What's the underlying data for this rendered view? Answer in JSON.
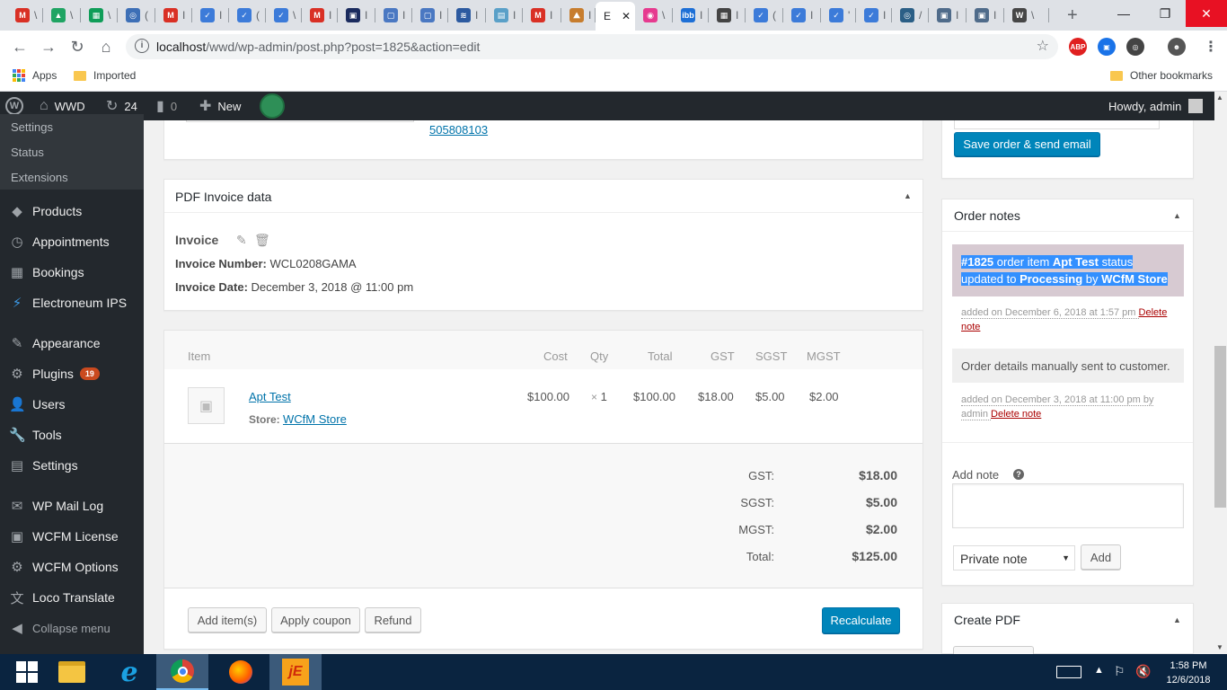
{
  "browser": {
    "tabs": [
      {
        "icon": "gmail-icon",
        "color": "#d93025",
        "letter": "M",
        "title": "\\"
      },
      {
        "icon": "drive-icon",
        "color": "#1fa463",
        "letter": "▲",
        "title": "\\"
      },
      {
        "icon": "sheets-icon",
        "color": "#0f9d58",
        "letter": "▦",
        "title": "\\"
      },
      {
        "icon": "site-icon",
        "color": "#3d6fb6",
        "letter": "◎",
        "title": "("
      },
      {
        "icon": "gmail-icon",
        "color": "#d93025",
        "letter": "M",
        "title": "I"
      },
      {
        "icon": "wcfm-icon",
        "color": "#3c7bd9",
        "letter": "✓",
        "title": "I"
      },
      {
        "icon": "wcfm-icon",
        "color": "#3c7bd9",
        "letter": "✓",
        "title": "("
      },
      {
        "icon": "wcfm-icon",
        "color": "#3c7bd9",
        "letter": "✓",
        "title": "\\"
      },
      {
        "icon": "gmail-icon",
        "color": "#d93025",
        "letter": "M",
        "title": "I"
      },
      {
        "icon": "site-icon",
        "color": "#1a2b5e",
        "letter": "▣",
        "title": "I"
      },
      {
        "icon": "doc-icon",
        "color": "#4a78c2",
        "letter": "▢",
        "title": "I"
      },
      {
        "icon": "doc-icon",
        "color": "#4a78c2",
        "letter": "▢",
        "title": "I"
      },
      {
        "icon": "site-icon",
        "color": "#2c5aa0",
        "letter": "≋",
        "title": "I"
      },
      {
        "icon": "site-icon",
        "color": "#5aa0c8",
        "letter": "▤",
        "title": "I"
      },
      {
        "icon": "gmail-icon",
        "color": "#d93025",
        "letter": "M",
        "title": "I"
      },
      {
        "icon": "site-icon",
        "color": "#c77d2e",
        "letter": "⛰",
        "title": "I"
      },
      {
        "icon": "active-tab",
        "color": "#ffffff",
        "letter": "",
        "title": "E"
      },
      {
        "icon": "site-icon",
        "color": "#e63a8f",
        "letter": "◉",
        "title": "\\"
      },
      {
        "icon": "site-icon",
        "color": "#1d6fd6",
        "letter": "ibb",
        "title": "I"
      },
      {
        "icon": "site-icon",
        "color": "#444444",
        "letter": "▦",
        "title": "I"
      },
      {
        "icon": "wcfm-icon",
        "color": "#3c7bd9",
        "letter": "✓",
        "title": "("
      },
      {
        "icon": "wcfm-icon",
        "color": "#3c7bd9",
        "letter": "✓",
        "title": "I"
      },
      {
        "icon": "wcfm-icon",
        "color": "#3c7bd9",
        "letter": "✓",
        "title": "'"
      },
      {
        "icon": "wcfm-icon",
        "color": "#3c7bd9",
        "letter": "✓",
        "title": "I"
      },
      {
        "icon": "site-icon",
        "color": "#2b5f86",
        "letter": "◎",
        "title": "/"
      },
      {
        "icon": "site-icon",
        "color": "#4f6b8a",
        "letter": "▣",
        "title": "I"
      },
      {
        "icon": "site-icon",
        "color": "#4f6b8a",
        "letter": "▣",
        "title": "I"
      },
      {
        "icon": "wordpress-icon",
        "color": "#464646",
        "letter": "W",
        "title": "\\"
      }
    ],
    "active_close": "✕",
    "new_tab": "+",
    "window_controls": {
      "minimize": "—",
      "restore": "❐",
      "close": "✕"
    },
    "url_host": "localhost",
    "url_path": "/wwd/wp-admin/post.php?post=1825&action=edit",
    "extensions": [
      "ABP",
      "▣",
      "◎",
      "☻",
      "⋮"
    ],
    "bookmarks": {
      "apps": "Apps",
      "imported": "Imported",
      "other": "Other bookmarks"
    }
  },
  "adminbar": {
    "site": "WWD",
    "updates": "24",
    "comments": "0",
    "new": "New",
    "howdy": "Howdy, admin"
  },
  "sidebar": {
    "submenu": [
      "Settings",
      "Status",
      "Extensions"
    ],
    "items": [
      {
        "label": "Products",
        "icon": "products-icon",
        "glyph": "◆"
      },
      {
        "label": "Appointments",
        "icon": "clock-icon",
        "glyph": "◷"
      },
      {
        "label": "Bookings",
        "icon": "calendar-icon",
        "glyph": "▦"
      },
      {
        "label": "Electroneum IPS",
        "icon": "electroneum-icon",
        "glyph": "⚡"
      },
      {
        "label": "Appearance",
        "icon": "brush-icon",
        "glyph": "✎"
      },
      {
        "label": "Plugins",
        "icon": "plugin-icon",
        "glyph": "⚙",
        "badge": "19"
      },
      {
        "label": "Users",
        "icon": "users-icon",
        "glyph": "👤"
      },
      {
        "label": "Tools",
        "icon": "wrench-icon",
        "glyph": "🔧"
      },
      {
        "label": "Settings",
        "icon": "settings-icon",
        "glyph": "▤"
      },
      {
        "label": "WP Mail Log",
        "icon": "mail-icon",
        "glyph": "✉"
      },
      {
        "label": "WCFM License",
        "icon": "license-icon",
        "glyph": "▣"
      },
      {
        "label": "WCFM Options",
        "icon": "gear-icon",
        "glyph": "⚙"
      },
      {
        "label": "Loco Translate",
        "icon": "translate-icon",
        "glyph": "文"
      },
      {
        "label": "Collapse menu",
        "icon": "collapse-icon",
        "glyph": "◀"
      }
    ]
  },
  "address": {
    "phone": "505808103"
  },
  "pdf_invoice": {
    "title": "PDF Invoice data",
    "subtitle": "Invoice",
    "number_label": "Invoice Number:",
    "number": "WCL0208GAMA",
    "date_label": "Invoice Date:",
    "date": "December 3, 2018 @ 11:00 pm"
  },
  "items": {
    "headers": {
      "item": "Item",
      "cost": "Cost",
      "qty": "Qty",
      "total": "Total",
      "gst": "GST",
      "sgst": "SGST",
      "mgst": "MGST"
    },
    "row": {
      "name": "Apt Test",
      "store_label": "Store:",
      "store": "WCfM Store",
      "cost": "$100.00",
      "qty_x": "×",
      "qty": "1",
      "total": "$100.00",
      "gst": "$18.00",
      "sgst": "$5.00",
      "mgst": "$2.00"
    }
  },
  "totals": [
    {
      "label": "GST:",
      "value": "$18.00"
    },
    {
      "label": "SGST:",
      "value": "$5.00"
    },
    {
      "label": "MGST:",
      "value": "$2.00"
    },
    {
      "label": "Total:",
      "value": "$125.00"
    }
  ],
  "buttons": {
    "add_items": "Add item(s)",
    "apply_coupon": "Apply coupon",
    "refund": "Refund",
    "recalculate": "Recalculate",
    "save_order": "Save order & send email",
    "add": "Add"
  },
  "order_notes": {
    "title": "Order notes",
    "note1": {
      "order": "#1825",
      "t1": " order item ",
      "item": "Apt Test",
      "t2": " status updated to ",
      "status": "Processing",
      "t3": " by ",
      "store": "WCfM Store",
      "meta": "added on December 6, 2018 at 1:57 pm ",
      "delete": "Delete note"
    },
    "note2": {
      "text": "Order details manually sent to customer.",
      "meta": "added on December 3, 2018 at 11:00 pm by admin ",
      "delete": "Delete note"
    },
    "add_note_label": "Add note",
    "help": "?",
    "note_type": "Private note"
  },
  "create_pdf": {
    "title": "Create PDF"
  },
  "taskbar": {
    "time": "1:58 PM",
    "date": "12/6/2018"
  }
}
